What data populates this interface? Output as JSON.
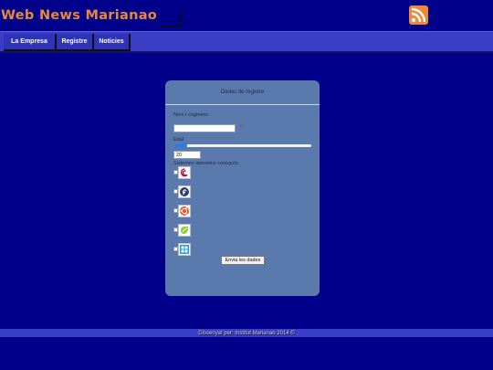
{
  "header": {
    "site_title": "Web News Marianao",
    "rss_icon": "rss-feed-icon",
    "title_color": "#e8883a"
  },
  "nav": {
    "items": [
      {
        "label": "La Empresa"
      },
      {
        "label": "Registre"
      },
      {
        "label": "Noticies"
      }
    ]
  },
  "form": {
    "title": "Dades de registre",
    "name_label": "Nom i cognoms",
    "name_value": "",
    "required_mark": "*",
    "age_label": "Edat",
    "age_value": "20",
    "age_slider_fraction": 0.07,
    "os_label": "Sistemes operatius coneguts",
    "os_options": [
      {
        "icon": "debian-icon",
        "checked": false
      },
      {
        "icon": "fedora-icon",
        "checked": false
      },
      {
        "icon": "ubuntu-icon",
        "checked": false
      },
      {
        "icon": "linux-mint-icon",
        "checked": false
      },
      {
        "icon": "windows-icon",
        "checked": false
      }
    ],
    "submit_label": "Envia les dades"
  },
  "footer": {
    "text": "Dissenyat per: Institut Marianao 2014 ©"
  },
  "colors": {
    "background": "#00008b",
    "navbar": "#3a3ec7",
    "panel": "#5a7aae",
    "accent": "#f0883a"
  }
}
